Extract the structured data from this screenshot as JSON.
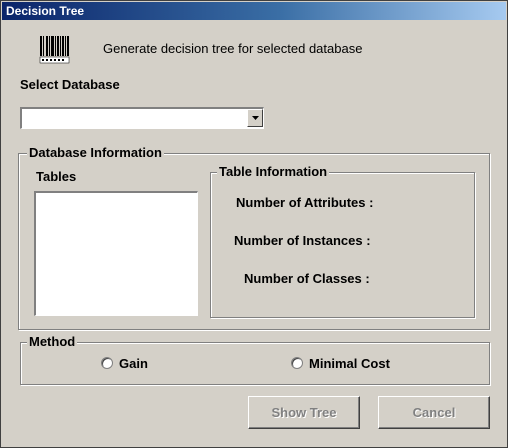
{
  "window": {
    "title": "Decision Tree"
  },
  "header": {
    "description": "Generate decision tree for selected database",
    "icon": "barcode-icon"
  },
  "select_database": {
    "label": "Select Database",
    "value": ""
  },
  "db_info": {
    "legend": "Database Information",
    "tables_label": "Tables",
    "tables": [],
    "table_info": {
      "legend": "Table Information",
      "attributes_label": "Number of Attributes :",
      "instances_label": "Number of Instances :",
      "classes_label": "Number of Classes :"
    }
  },
  "method": {
    "legend": "Method",
    "options": [
      {
        "label": "Gain",
        "selected": false
      },
      {
        "label": "Minimal Cost",
        "selected": false
      }
    ]
  },
  "buttons": {
    "show_tree": "Show Tree",
    "cancel": "Cancel",
    "enabled": false
  }
}
